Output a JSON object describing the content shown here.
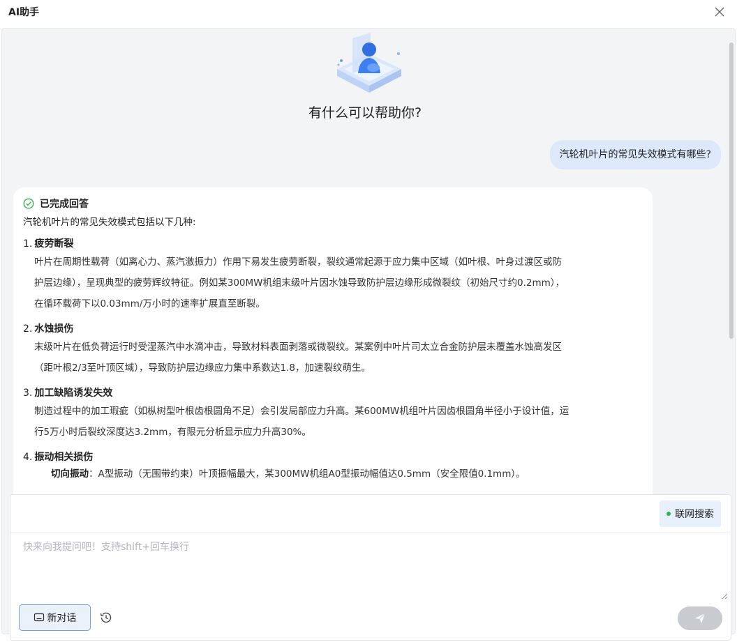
{
  "window": {
    "title": "AI助手",
    "close_icon": "close-icon"
  },
  "hero": {
    "greeting": "有什么可以帮助你?",
    "avatar_icon": "ai-assistant-avatar-icon"
  },
  "user_message": "汽轮机叶片的常见失效模式有哪些?",
  "answer": {
    "status": "已完成回答",
    "intro": "汽轮机叶片的常见失效模式包括以下几种:",
    "sections": [
      {
        "num": "1.",
        "title": "疲劳断裂",
        "lines": [
          "叶片在周期性载荷（如离心力、蒸汽激振力）作用下易发生疲劳断裂，裂纹通常起源于应力集中区域（如叶根、叶身过渡区或防",
          "护层边缘），呈现典型的疲劳辉纹特征。例如某300MW机组末级叶片因水蚀导致防护层边缘形成微裂纹（初始尺寸约0.2mm），",
          "在循环载荷下以0.03mm/万小时的速率扩展直至断裂。"
        ]
      },
      {
        "num": "2.",
        "title": "水蚀损伤",
        "lines": [
          "末级叶片在低负荷运行时受湿蒸汽中水滴冲击，导致材料表面剥落或微裂纹。某案例中叶片司太立合金防护层未覆盖水蚀高发区",
          "（距叶根2/3至叶顶区域），导致防护层边缘应力集中系数达1.8，加速裂纹萌生。"
        ]
      },
      {
        "num": "3.",
        "title": "加工缺陷诱发失效",
        "lines": [
          "制造过程中的加工瑕疵（如枞树型叶根齿根圆角不足）会引发局部应力升高。某600MW机组叶片因齿根圆角半径小于设计值，运",
          "行5万小时后裂纹深度达3.2mm，有限元分析显示应力升高30%。"
        ]
      },
      {
        "num": "4.",
        "title": "振动相关损伤",
        "sub_label": "切向振动",
        "sub_text": "：A型振动（无围带约束）叶顶振幅最大，某300MW机组A0型振动幅值达0.5mm（安全限值0.1mm）。"
      }
    ]
  },
  "input": {
    "web_search_label": "联网搜索",
    "placeholder": "快来向我提问吧！支持shift+回车换行",
    "value": "",
    "new_chat_label": "新对话"
  },
  "colors": {
    "accent": "#3a7be0",
    "user_bubble": "#dde9fb",
    "status_green": "#2db34a",
    "send_disabled": "#c8cbd0"
  }
}
